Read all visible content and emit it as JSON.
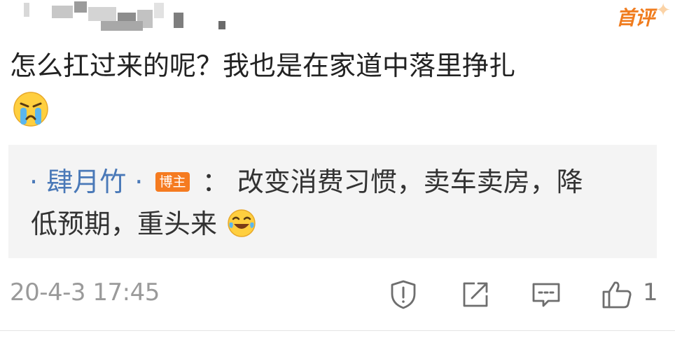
{
  "comment": {
    "badge": "首评",
    "text": "怎么扛过来的呢？我也是在家道中落里挣扎",
    "emoji": "crying-face-icon"
  },
  "reply": {
    "prefix": "·",
    "username": "肆月竹",
    "suffix": "·",
    "role_badge": "博主",
    "separator": "：",
    "text_line1": "改变消费习惯，卖车卖房，降",
    "text_line2": "低预期，重头来",
    "emoji": "laughing-tears-icon"
  },
  "meta": {
    "timestamp": "20-4-3 17:45",
    "like_count": "1"
  },
  "actions": [
    "report-icon",
    "share-icon",
    "comment-icon",
    "like-icon"
  ],
  "colors": {
    "link": "#4a79b8",
    "badge_orange": "#f57b20",
    "muted": "#9a9a9a",
    "reply_bg": "#f4f4f4"
  }
}
